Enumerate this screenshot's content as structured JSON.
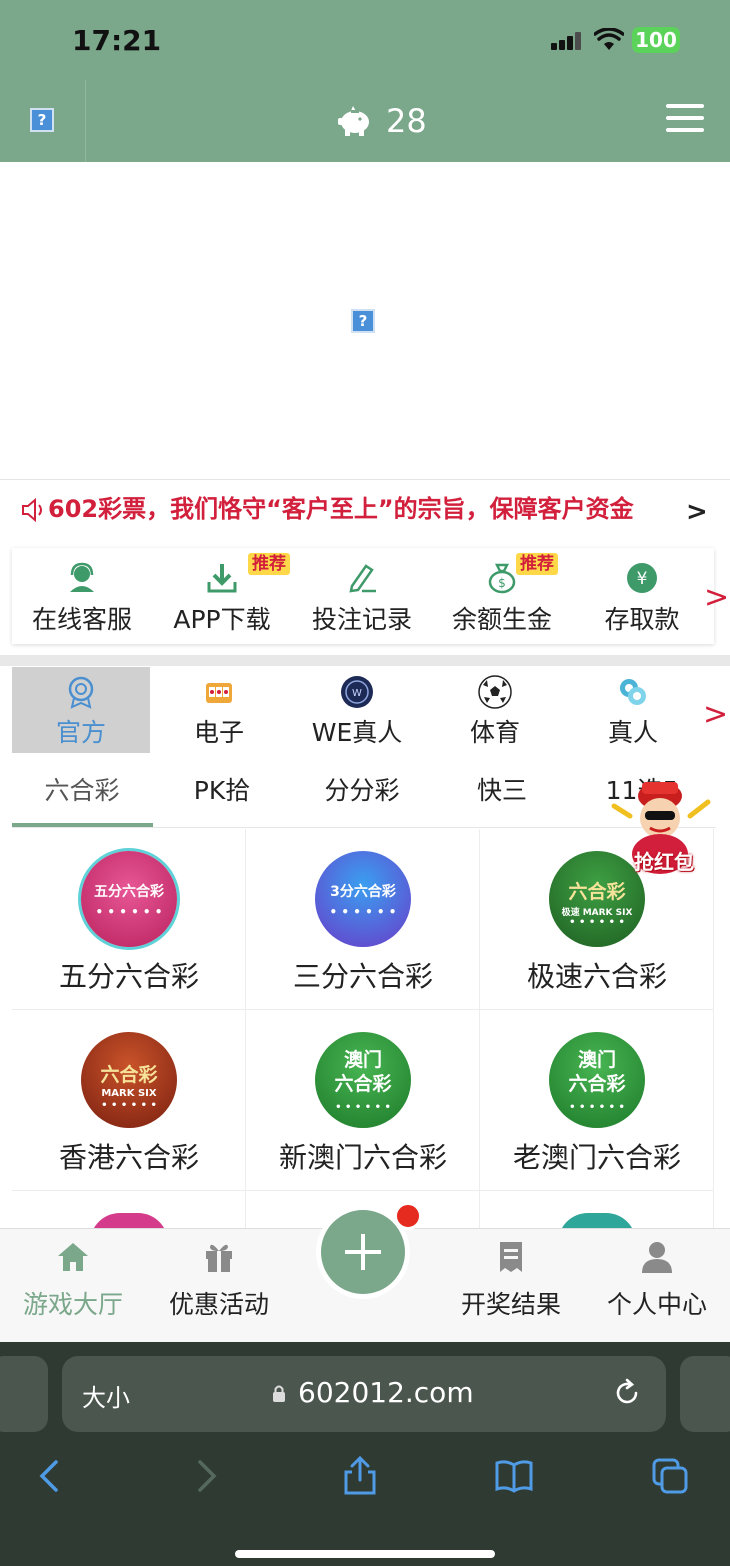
{
  "status": {
    "time": "17:21",
    "battery": "100"
  },
  "header": {
    "count": "28",
    "piggy_icon": "piggy-bank-icon",
    "menu_icon": "hamburger-menu-icon"
  },
  "notice": {
    "text": "602彩票，我们恪守“客户至上”的宗旨，保障客户资金"
  },
  "quick_menu": [
    {
      "label": "在线客服",
      "icon": "customer-service-icon"
    },
    {
      "label": "APP下载",
      "icon": "download-icon",
      "badge": "推荐"
    },
    {
      "label": "投注记录",
      "icon": "edit-record-icon"
    },
    {
      "label": "余额生金",
      "icon": "money-bag-icon",
      "badge": "推荐"
    },
    {
      "label": "存取款",
      "icon": "yen-icon"
    }
  ],
  "categories": [
    {
      "label": "官方",
      "icon": "official-badge-icon",
      "active": true
    },
    {
      "label": "电子",
      "icon": "slot-machine-icon"
    },
    {
      "label": "WE真人",
      "icon": "we-logo-icon"
    },
    {
      "label": "体育",
      "icon": "soccer-ball-icon"
    },
    {
      "label": "真人",
      "icon": "chips-icon"
    }
  ],
  "subtabs": [
    {
      "label": "六合彩",
      "active": true
    },
    {
      "label": "PK拾"
    },
    {
      "label": "分分彩"
    },
    {
      "label": "快三"
    },
    {
      "label": "11选5"
    }
  ],
  "hongbao": {
    "label": "抢红包"
  },
  "games": [
    {
      "name": "五分六合彩",
      "logo": "五分六合彩",
      "color": "#c9336f"
    },
    {
      "name": "三分六合彩",
      "logo": "3分六合彩",
      "color": "#4a4fd1"
    },
    {
      "name": "极速六合彩",
      "logo": "六合彩",
      "sub": "极速 MARK SIX",
      "color": "#2e7d32"
    },
    {
      "name": "香港六合彩",
      "logo": "六合彩",
      "sub": "MARK SIX",
      "color": "#a8371a"
    },
    {
      "name": "新澳门六合彩",
      "logo": "澳门\n六合彩",
      "color": "#2f9e3a"
    },
    {
      "name": "老澳门六合彩",
      "logo": "澳门\n六合彩",
      "color": "#2f9e3a"
    }
  ],
  "tabbar": [
    {
      "label": "游戏大厅",
      "icon": "home-icon",
      "active": true
    },
    {
      "label": "优惠活动",
      "icon": "gift-icon"
    },
    {
      "label": "",
      "icon": "plus-icon"
    },
    {
      "label": "开奖结果",
      "icon": "receipt-icon"
    },
    {
      "label": "个人中心",
      "icon": "person-icon"
    }
  ],
  "browser": {
    "aa": "大小",
    "url": "602012.com"
  },
  "colors": {
    "brand": "#7ba78b",
    "accent_red": "#d21f3c",
    "active_blue": "#4a8fcf"
  }
}
